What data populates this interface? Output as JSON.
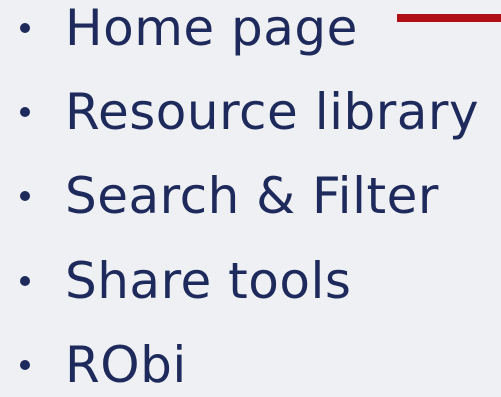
{
  "slide": {
    "items": [
      {
        "label": "Home page"
      },
      {
        "label": "Resource library"
      },
      {
        "label": "Search & Filter"
      },
      {
        "label": "Share tools"
      },
      {
        "label": "RObi"
      }
    ],
    "accent_color": "#b00f15",
    "text_color": "#1f2a5c",
    "background_color": "#eef0f3"
  }
}
